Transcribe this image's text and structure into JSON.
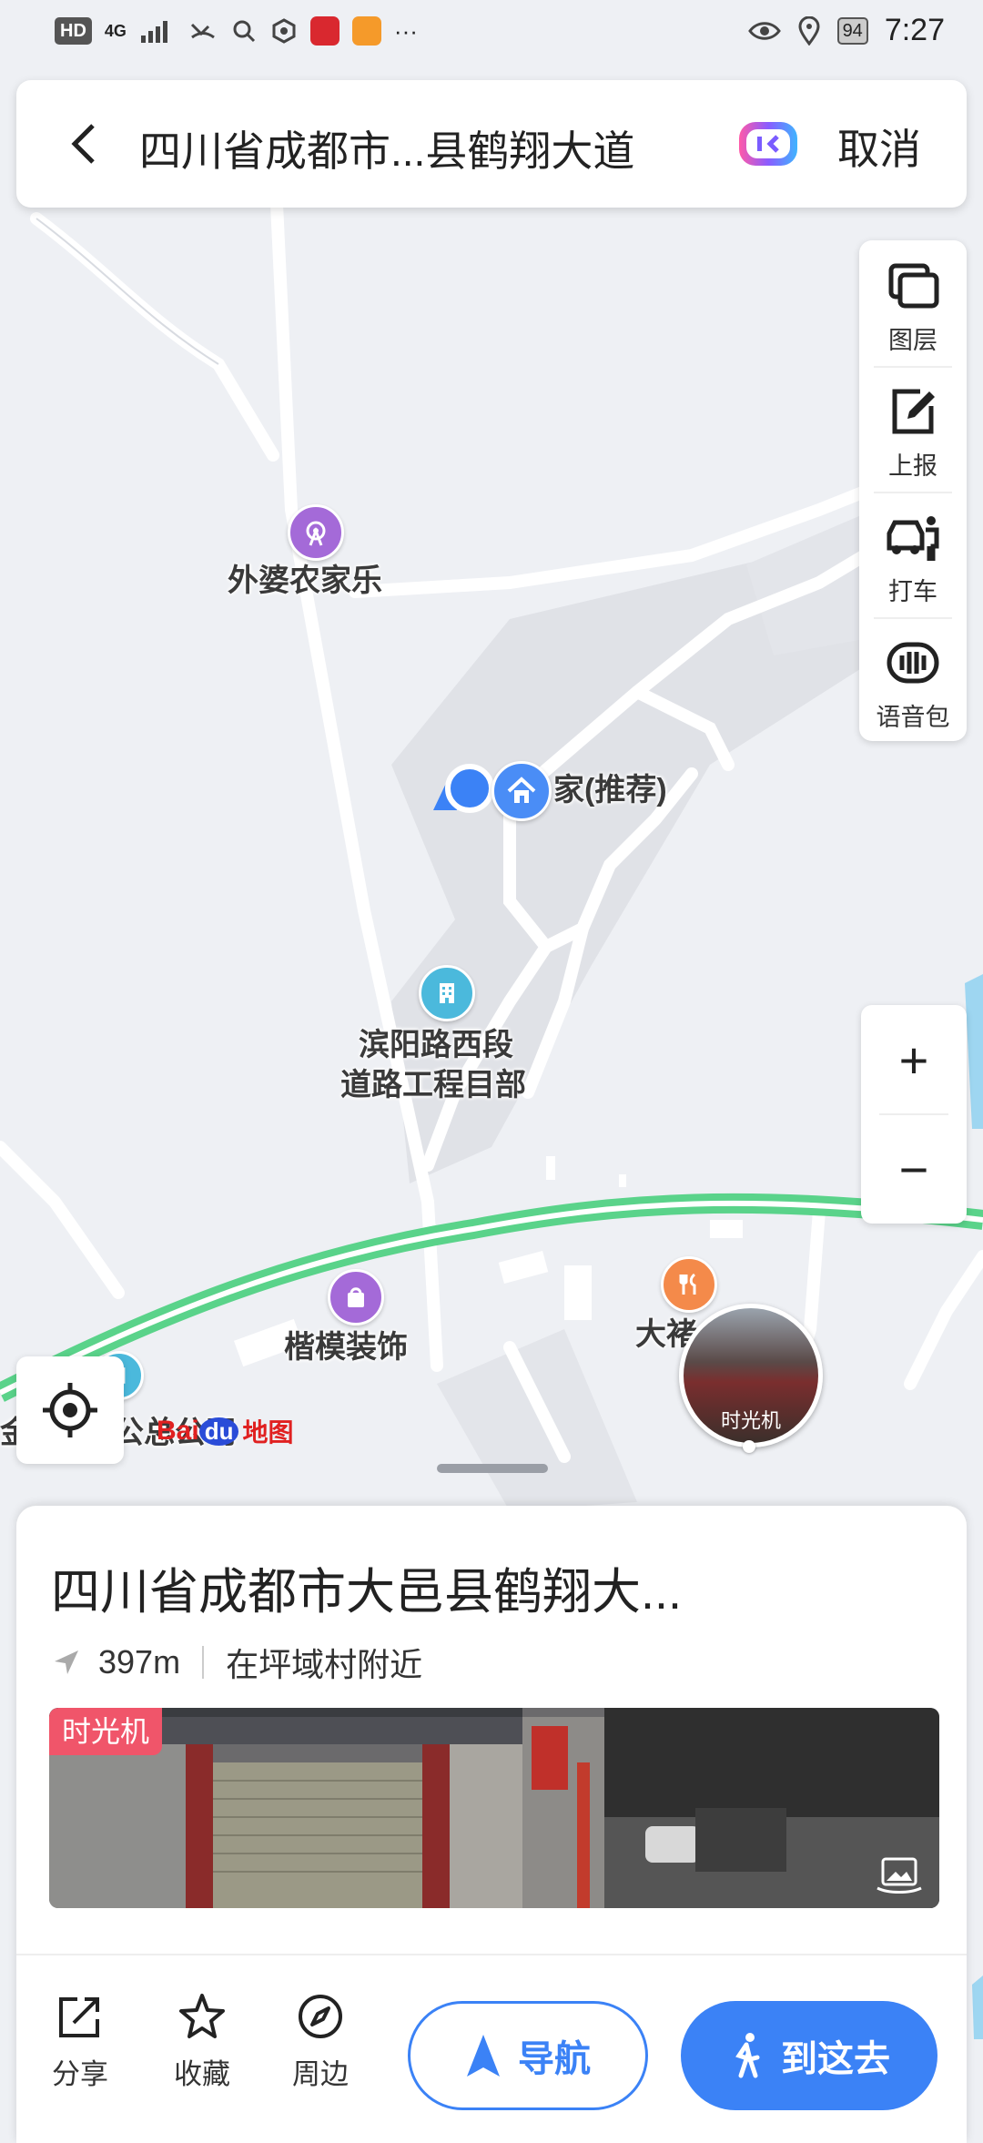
{
  "status_bar": {
    "hd": "HD",
    "network": "4G",
    "battery": "94",
    "time": "7:27",
    "more": "···"
  },
  "search_bar": {
    "back_icon": "chevron-left-icon",
    "title": "四川省成都市...县鹤翔大道",
    "cancel_label": "取消"
  },
  "tools": [
    {
      "label": "图层",
      "icon": "layers-icon"
    },
    {
      "label": "上报",
      "icon": "report-edit-icon"
    },
    {
      "label": "打车",
      "icon": "taxi-icon"
    },
    {
      "label": "语音包",
      "icon": "voice-pack-icon"
    }
  ],
  "zoom": {
    "in": "+",
    "out": "−"
  },
  "map": {
    "poi_labels": {
      "waipo": "外婆农家乐",
      "home": "家(推荐)",
      "binyang_1": "滨阳路西段",
      "binyang_2": "道路工程目部",
      "kaimo": "楷模装饰",
      "dazi": "大褚",
      "company": "金",
      "company2": "公总公司"
    },
    "time_machine_label": "时光机",
    "brand_left": "Bai",
    "brand_du": "du",
    "brand_right": "地图"
  },
  "sheet": {
    "title": "四川省成都市大邑县鹤翔大...",
    "distance": "397m",
    "nearby": "在坪域村附近",
    "photo_badge": "时光机",
    "actions": {
      "share": "分享",
      "favorite": "收藏",
      "around": "周边",
      "navigate": "导航",
      "go_here": "到这去"
    }
  },
  "colors": {
    "accent_blue": "#3b82f6",
    "road_green": "#5ad38a",
    "badge_red": "#f0556a",
    "poi_purple": "#a46ad8",
    "poi_teal": "#4bb9dc",
    "poi_orange": "#f48a4a"
  }
}
